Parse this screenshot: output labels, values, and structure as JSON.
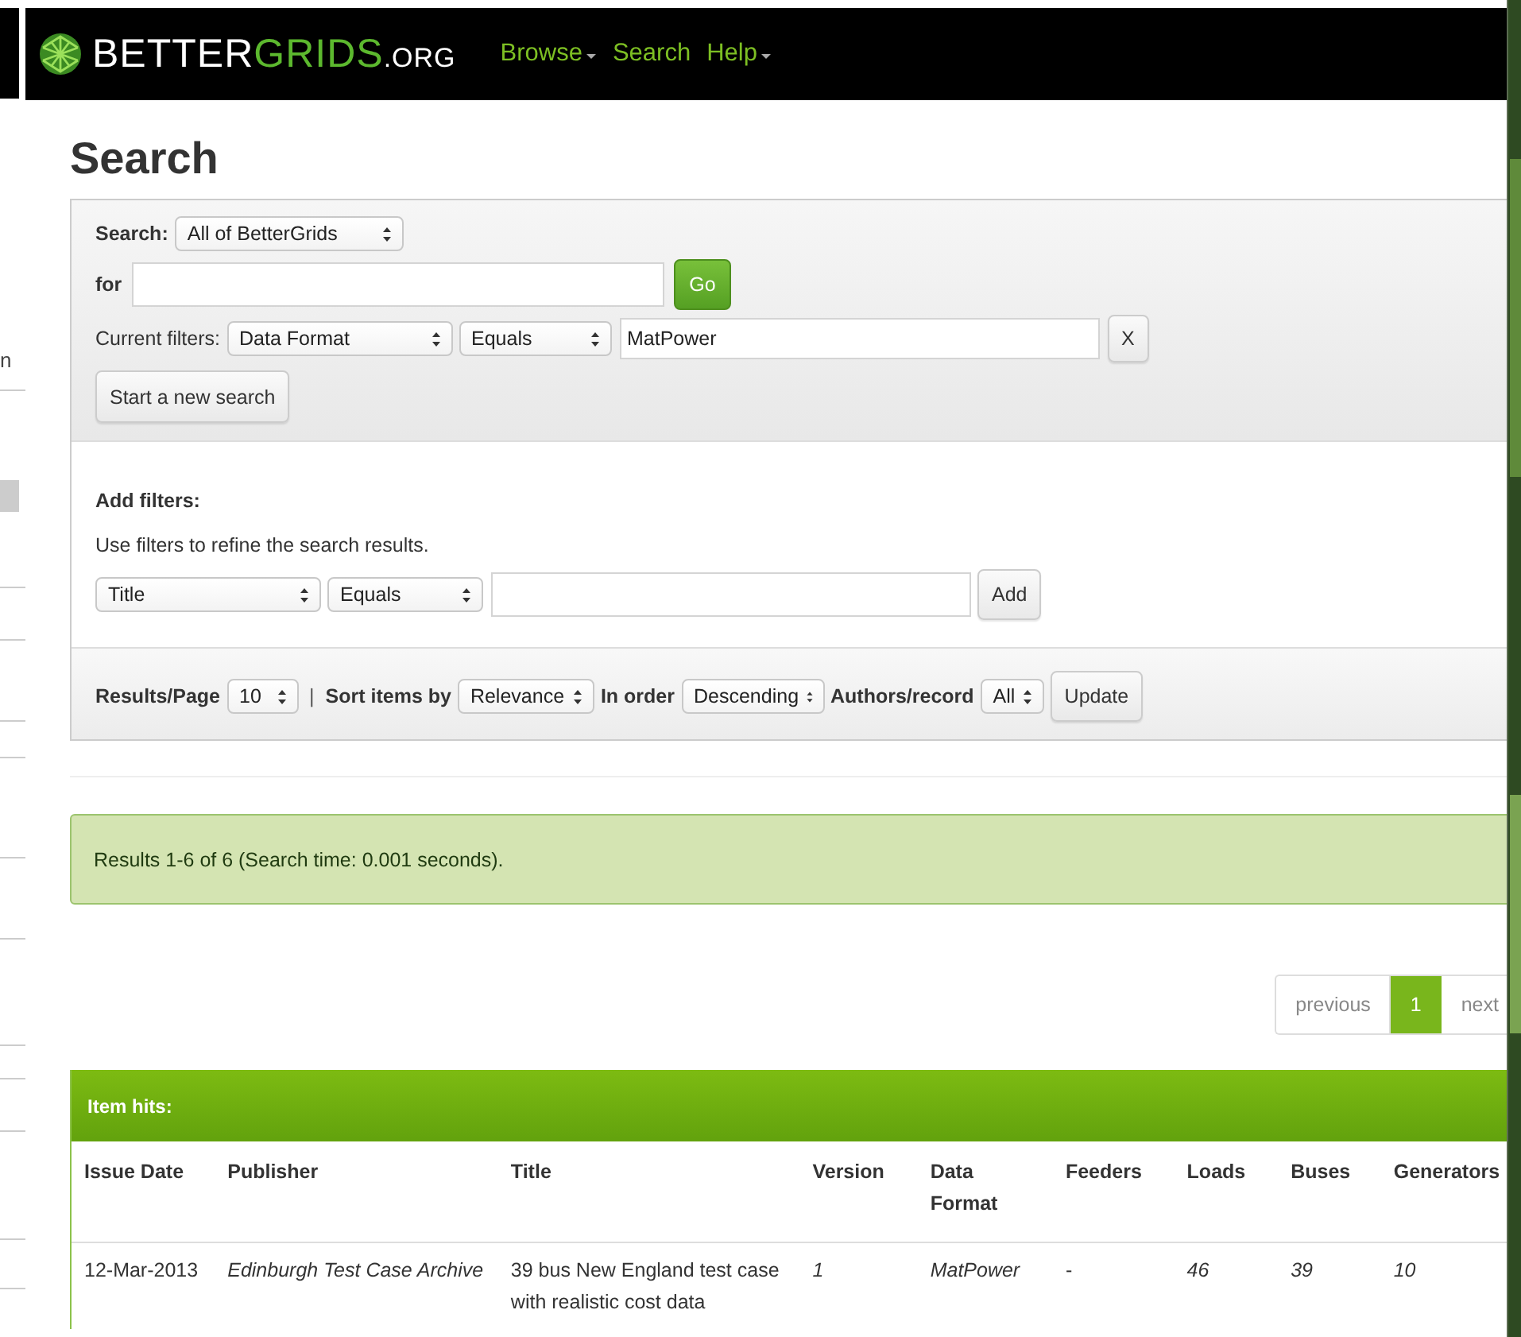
{
  "background_window": {
    "fragment_text": "n"
  },
  "header": {
    "logo": {
      "brand": "BETTER",
      "brand_accent": "GRIDS",
      "suffix": ".ORG"
    },
    "nav": [
      {
        "label": "Browse",
        "dropdown": true
      },
      {
        "label": "Search",
        "dropdown": false
      },
      {
        "label": "Help",
        "dropdown": true
      }
    ]
  },
  "page_title": "Search",
  "search_form": {
    "scope_label": "Search:",
    "scope": "All of BetterGrids",
    "for_label": "for",
    "go_button": "Go",
    "current_filters_label": "Current filters:",
    "current_filter": {
      "field": "Data Format",
      "operator": "Equals",
      "value": "MatPower",
      "remove_button": "X"
    },
    "new_search_button": "Start a new search"
  },
  "add_filters": {
    "heading": "Add filters:",
    "hint": "Use filters to refine the search results.",
    "field": "Title",
    "operator": "Equals",
    "add_button": "Add"
  },
  "results_options": {
    "per_page_label": "Results/Page",
    "per_page": "10",
    "separator": "|",
    "sort_label": "Sort items by",
    "sort": "Relevance",
    "order_label": "In order",
    "order": "Descending",
    "authors_label": "Authors/record",
    "authors": "All",
    "update_button": "Update"
  },
  "results_alert": "Results 1-6 of 6 (Search time: 0.001 seconds).",
  "pagination": [
    {
      "label": "previous",
      "selected": false
    },
    {
      "label": "1",
      "selected": true
    },
    {
      "label": "next",
      "selected": false
    }
  ],
  "item_hits": {
    "heading": "Item hits:",
    "table": {
      "columns": [
        "Issue Date",
        "Publisher",
        "Title",
        "Version",
        "Data Format",
        "Feeders",
        "Loads",
        "Buses",
        "Generators"
      ],
      "rows": [
        {
          "cells": [
            {
              "text": "12-Mar-2013",
              "italic": false
            },
            {
              "text": "Edinburgh Test Case Archive",
              "italic": true
            },
            {
              "text": "39 bus New England test case with realistic cost data",
              "italic": false
            },
            {
              "text": "1",
              "italic": true
            },
            {
              "text": "MatPower",
              "italic": true
            },
            {
              "text": "-",
              "italic": false
            },
            {
              "text": "46",
              "italic": true
            },
            {
              "text": "39",
              "italic": true
            },
            {
              "text": "10",
              "italic": true
            }
          ]
        }
      ]
    }
  }
}
